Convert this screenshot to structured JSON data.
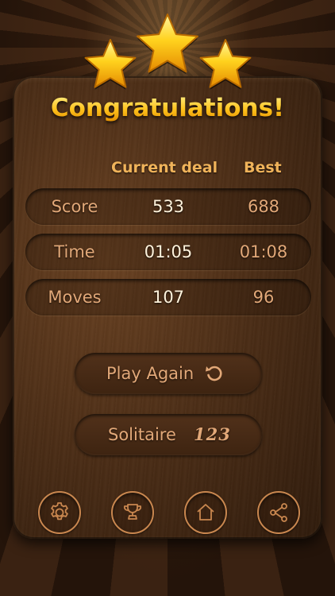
{
  "title": "Congratulations!",
  "rating": {
    "stars_earned": 3,
    "stars_total": 3,
    "star_color": "#ffc21c"
  },
  "stats": {
    "headers": {
      "current": "Current deal",
      "best": "Best"
    },
    "rows": [
      {
        "label": "Score",
        "current": "533",
        "best": "688"
      },
      {
        "label": "Time",
        "current": "01:05",
        "best": "01:08"
      },
      {
        "label": "Moves",
        "current": "107",
        "best": "96"
      }
    ]
  },
  "buttons": {
    "play_again": {
      "label": "Play Again",
      "icon": "restart-icon"
    },
    "solitaire": {
      "label": "Solitaire",
      "glyph": "123"
    }
  },
  "bottom_bar": [
    {
      "icon": "settings-icon"
    },
    {
      "icon": "trophy-icon"
    },
    {
      "icon": "home-icon"
    },
    {
      "icon": "share-icon"
    }
  ],
  "colors": {
    "title_gold": "#ffd23a",
    "header_orange": "#f0b35a",
    "label_tan": "#e2a878",
    "value_cream": "#fff3dc",
    "icon_ring": "#c9874f"
  }
}
